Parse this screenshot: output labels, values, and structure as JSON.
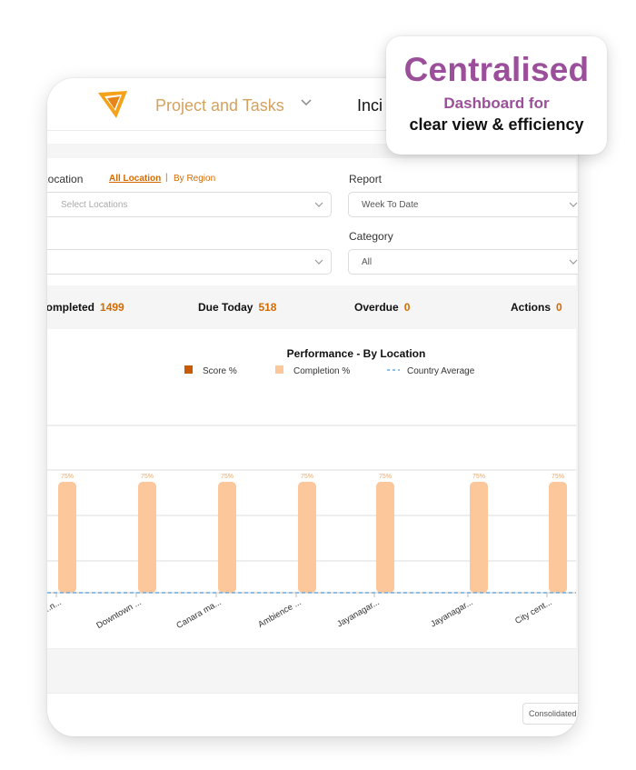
{
  "callout": {
    "title": "Centralised",
    "subtitle": "Dashboard for",
    "tagline": "clear view & efficiency"
  },
  "topbar": {
    "logo_icon": "paper-plane-logo-icon",
    "nav_item_project": "Project and Tasks",
    "nav_item_incidents": "Inci"
  },
  "filters": {
    "location_label": "Location",
    "location_link_all": "All Location",
    "location_link_separator": "|",
    "location_link_region": "By Region",
    "location_placeholder": "Select Locations",
    "report_label": "Report",
    "report_value": "Week To Date",
    "category_label": "Category",
    "category_value": "All"
  },
  "stats": [
    {
      "label": "Completed",
      "value": "1499"
    },
    {
      "label": "Due Today",
      "value": "518"
    },
    {
      "label": "Overdue",
      "value": "0"
    },
    {
      "label": "Actions",
      "value": "0"
    }
  ],
  "colors": {
    "accent": "#d46b00",
    "brand_purple": "#9b4f9a",
    "score_series": "#c85a00",
    "completion_series": "#fcc89b",
    "country_average": "#6fa8dc"
  },
  "chart_data": {
    "type": "bar",
    "title": "Performance - By Location",
    "legend": [
      "Score %",
      "Completion %",
      "Country Average"
    ],
    "legend_position": "top",
    "categories": [
      "...n...",
      "Downtown ...",
      "Canara ma...",
      "Ambience ...",
      "Jayanagar...",
      "Jayanagar...",
      "City cent..."
    ],
    "series": [
      {
        "name": "Score %",
        "values": [
          0,
          0,
          0,
          0,
          0,
          0,
          0
        ]
      },
      {
        "name": "Completion %",
        "values": [
          75,
          75,
          75,
          75,
          75,
          75,
          75
        ]
      },
      {
        "name": "Country Average",
        "values": [
          0,
          0,
          0,
          0,
          0,
          0,
          0
        ]
      }
    ],
    "data_label": "75%",
    "ylim": [
      0,
      100
    ],
    "grid": true
  },
  "bottom": {
    "consolidated_label": "Consolidated"
  }
}
